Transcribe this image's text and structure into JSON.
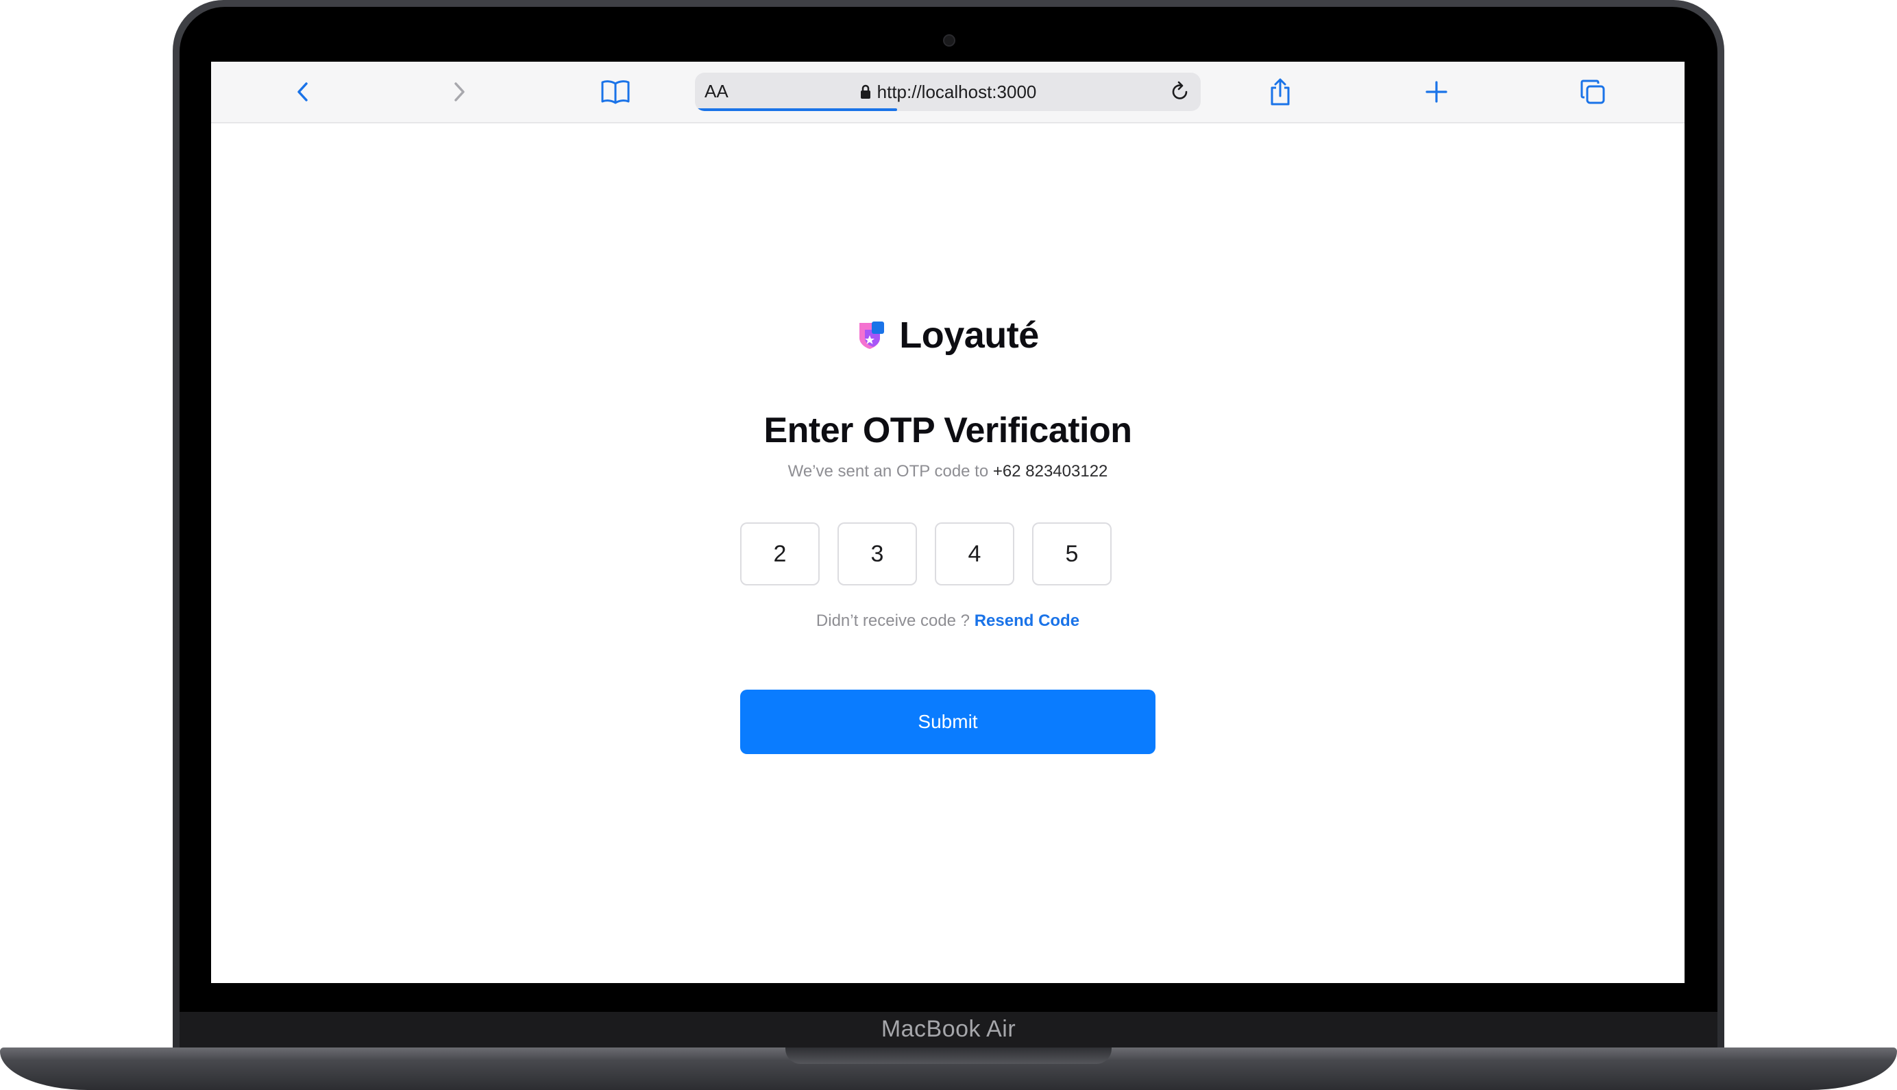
{
  "device": {
    "model_label": "MacBook Air"
  },
  "browser": {
    "text_size_label": "AA",
    "url": "http://localhost:3000",
    "icons": {
      "back": "chevron-left-icon",
      "forward": "chevron-right-icon",
      "bookmarks": "book-icon",
      "lock": "lock-icon",
      "reload": "reload-icon",
      "share": "share-icon",
      "new_tab": "plus-icon",
      "tabs": "tabs-icon"
    },
    "accent_color": "#1a73e8"
  },
  "page": {
    "brand": {
      "name": "Loyauté",
      "logo_colors": [
        "#f472d0",
        "#a855f7",
        "#1a73e8"
      ]
    },
    "title": "Enter OTP Verification",
    "subtitle_prefix": "We’ve sent an OTP code to",
    "phone": "+62 823403122",
    "otp_digits": [
      "2",
      "3",
      "4",
      "5"
    ],
    "resend_prompt": "Didn’t receive code ?",
    "resend_link": "Resend Code",
    "submit_label": "Submit",
    "submit_color": "#0a7cff"
  }
}
